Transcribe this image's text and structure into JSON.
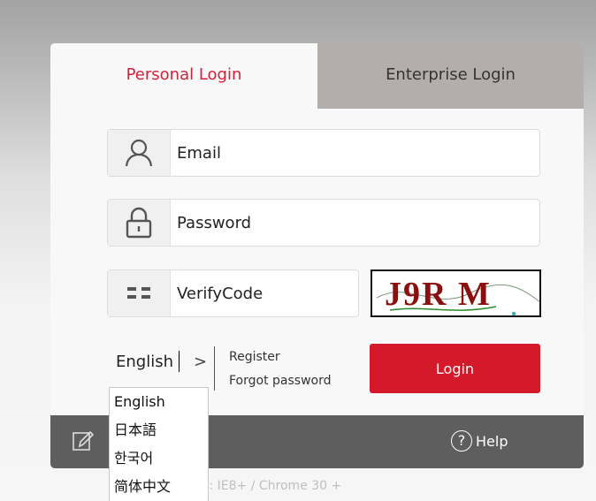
{
  "tabs": {
    "personal": "Personal Login",
    "enterprise": "Enterprise Login"
  },
  "form": {
    "email_placeholder": "Email",
    "password_placeholder": "Password",
    "verify_placeholder": "VerifyCode",
    "captcha_text": "J9R M"
  },
  "language": {
    "current": "English",
    "chevron": ">",
    "options": [
      "English",
      "日本語",
      "한국어",
      "简体中文"
    ]
  },
  "links": {
    "register": "Register",
    "forgot": "Forgot password"
  },
  "login_label": "Login",
  "footer": {
    "help_label": "Help",
    "help_symbol": "?"
  },
  "browser_requirements": "er requirements: IE8+ / Chrome 30 +",
  "icons": {
    "email": "user-icon",
    "password": "lock-icon",
    "verify": "code-icon",
    "footer_left": "edit-icon",
    "help": "help-icon"
  },
  "colors": {
    "accent": "#d4203a",
    "login_button": "#d4192b",
    "footer_bg": "#5e5e5e",
    "enterprise_tab_bg": "#b3aeab"
  }
}
